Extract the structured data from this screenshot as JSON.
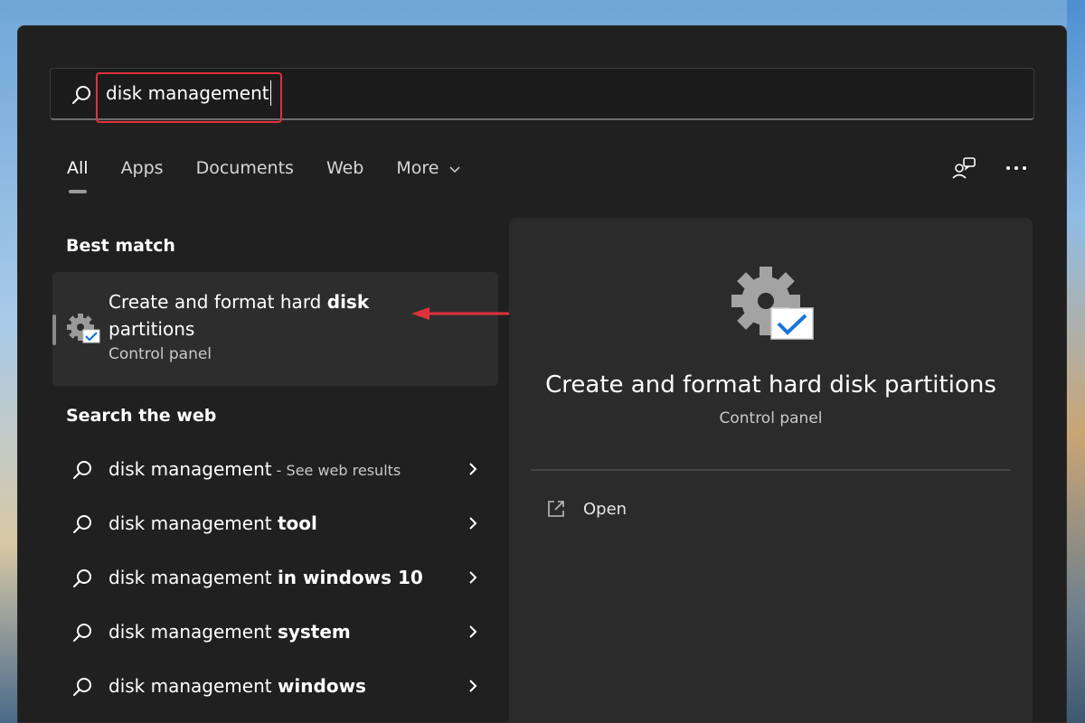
{
  "search": {
    "query": "disk management"
  },
  "tabs": [
    {
      "label": "All",
      "active": true
    },
    {
      "label": "Apps",
      "active": false
    },
    {
      "label": "Documents",
      "active": false
    },
    {
      "label": "Web",
      "active": false
    },
    {
      "label": "More",
      "active": false
    }
  ],
  "toolbar_icons": [
    "people-feedback-icon",
    "more-options-icon"
  ],
  "best_match": {
    "section_title": "Best match",
    "title_prefix": "Create and format hard ",
    "title_bold": "disk",
    "title_suffix": "partitions",
    "subtitle": "Control panel",
    "icon": "gear-check-icon"
  },
  "web": {
    "section_title": "Search the web",
    "items": [
      {
        "prefix": "disk management",
        "bold": "",
        "hint": " - See web results"
      },
      {
        "prefix": "disk management ",
        "bold": "tool",
        "hint": ""
      },
      {
        "prefix": "disk management ",
        "bold": "in windows 10",
        "hint": ""
      },
      {
        "prefix": "disk management ",
        "bold": "system",
        "hint": ""
      },
      {
        "prefix": "disk management ",
        "bold": "windows",
        "hint": ""
      }
    ]
  },
  "preview": {
    "title": "Create and format hard disk partitions",
    "subtitle": "Control panel",
    "actions": [
      {
        "label": "Open",
        "icon": "open-external-icon"
      }
    ]
  },
  "colors": {
    "panel_bg": "#202020",
    "card_bg": "#2d2d2d",
    "highlight_red": "#e0313a",
    "check_blue": "#1a73d9"
  }
}
